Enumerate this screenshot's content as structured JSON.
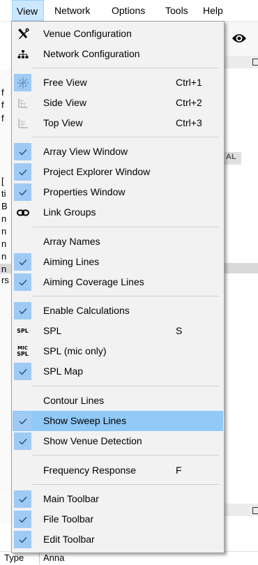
{
  "menubar": {
    "items": [
      {
        "label": "View"
      },
      {
        "label": "Network"
      },
      {
        "label": "Options"
      },
      {
        "label": "Tools"
      },
      {
        "label": "Help"
      }
    ]
  },
  "background": {
    "al_label": "AL",
    "type_label": "Type",
    "type_value": "Anna"
  },
  "view_menu": {
    "items": [
      {
        "label": "Venue Configuration",
        "icon": "tools-icon",
        "checked": false
      },
      {
        "label": "Network Configuration",
        "icon": "network-icon",
        "checked": false
      },
      {
        "label": "Free View",
        "shortcut": "Ctrl+1",
        "icon": "free-view-icon",
        "checked": true
      },
      {
        "label": "Side View",
        "shortcut": "Ctrl+2",
        "icon": "side-view-icon",
        "checked": false
      },
      {
        "label": "Top View",
        "shortcut": "Ctrl+3",
        "icon": "top-view-icon",
        "checked": false
      },
      {
        "label": "Array View Window",
        "checked": true
      },
      {
        "label": "Project Explorer Window",
        "checked": true
      },
      {
        "label": "Properties Window",
        "checked": true
      },
      {
        "label": "Link Groups",
        "icon": "link-icon",
        "checked": false
      },
      {
        "label": "Array Names",
        "checked": false
      },
      {
        "label": "Aiming Lines",
        "checked": true
      },
      {
        "label": "Aiming Coverage Lines",
        "checked": true
      },
      {
        "label": "Enable Calculations",
        "checked": true
      },
      {
        "label": "SPL",
        "shortcut": "S",
        "icon": "spl-icon",
        "icon_text": "SPL",
        "checked": false
      },
      {
        "label": "SPL (mic only)",
        "icon": "spl-mic-icon",
        "icon_text_top": "MIC",
        "icon_text_bottom": "SPL",
        "checked": false
      },
      {
        "label": "SPL Map",
        "checked": true
      },
      {
        "label": "Contour Lines",
        "checked": false
      },
      {
        "label": "Show Sweep Lines",
        "checked": true,
        "highlighted": true
      },
      {
        "label": "Show Venue Detection",
        "checked": true
      },
      {
        "label": "Frequency Response",
        "shortcut": "F",
        "checked": false
      },
      {
        "label": "Main Toolbar",
        "checked": true
      },
      {
        "label": "File Toolbar",
        "checked": true
      },
      {
        "label": "Edit Toolbar",
        "checked": true
      }
    ]
  },
  "colors": {
    "menu_bg": "#f2f2f2",
    "highlight": "#91c9f7",
    "checked_gutter": "#9fcaf4",
    "menubar_active": "#cce8ff"
  }
}
